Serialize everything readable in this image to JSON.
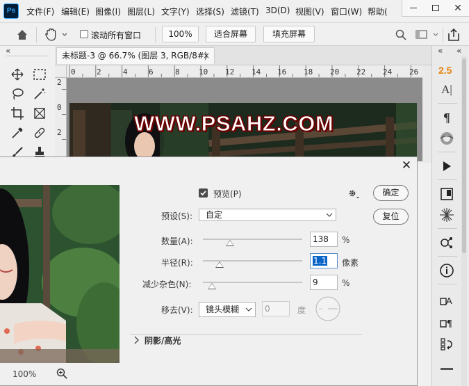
{
  "app": {
    "logo": "Ps",
    "menu": [
      "文件(F)",
      "编辑(E)",
      "图像(I)",
      "图层(L)",
      "文字(Y)",
      "选择(S)",
      "滤镜(T)",
      "3D(D)",
      "视图(V)",
      "窗口(W)",
      "帮助("
    ]
  },
  "window_controls": {
    "minimize": "—",
    "maximize": "□",
    "close": "✕"
  },
  "options_bar": {
    "home_icon": "home-icon",
    "hand_icon": "hand-icon",
    "scroll_all_label": "滚动所有窗口",
    "zoom_value": "100%",
    "fit_screen_label": "适合屏幕",
    "fill_screen_label": "填充屏幕",
    "search_icon": "search-icon",
    "workspace_icon": "workspace-icon",
    "share_icon": "share-icon"
  },
  "panel_collapse": {
    "left": "«",
    "right": "«",
    "far_right": "«"
  },
  "document": {
    "tab_title": "未标题-3 @ 66.7% (图层 3, RGB/8#) *",
    "tab_close": "×",
    "ruler_h": [
      "0",
      "2",
      "4",
      "6",
      "8",
      "10",
      "12",
      "14",
      "16",
      "18",
      "20",
      "22",
      "24",
      "26"
    ],
    "ruler_v": [
      "2",
      "0",
      "2"
    ],
    "watermark": "WWW.PSAHZ.COM"
  },
  "right_panel": {
    "character_value": "2.5",
    "icons": [
      "character-icon",
      "paragraph-icon",
      "swatches-icon",
      "play-icon",
      "libraries-icon",
      "brush-icon",
      "channels-icon",
      "info-icon",
      "character-styles-icon",
      "paragraph-styles-icon",
      "history-icon"
    ]
  },
  "dialog": {
    "close": "✕",
    "preview_label": "预览(P)",
    "preview_checked": true,
    "ok_label": "确定",
    "reset_label": "复位",
    "preset_label": "预设(S):",
    "preset_value": "自定",
    "amount_label": "数量(A):",
    "amount_value": "138",
    "amount_unit": "%",
    "amount_level": 0.27,
    "radius_label": "半径(R):",
    "radius_value": "1.1",
    "radius_unit": "像素",
    "radius_level": 0.17,
    "noise_label": "减少杂色(N):",
    "noise_value": "9",
    "noise_unit": "%",
    "noise_level": 0.09,
    "remove_label": "移去(V):",
    "remove_value": "镜头模糊",
    "angle_value": "0",
    "angle_unit": "度",
    "shadow_highlight_label": "阴影/高光",
    "zoom_level": "100%"
  },
  "colors": {
    "accent_orange": "#e8830c",
    "selection_blue": "#0a64c8",
    "ps_blue": "#31a8ff"
  }
}
